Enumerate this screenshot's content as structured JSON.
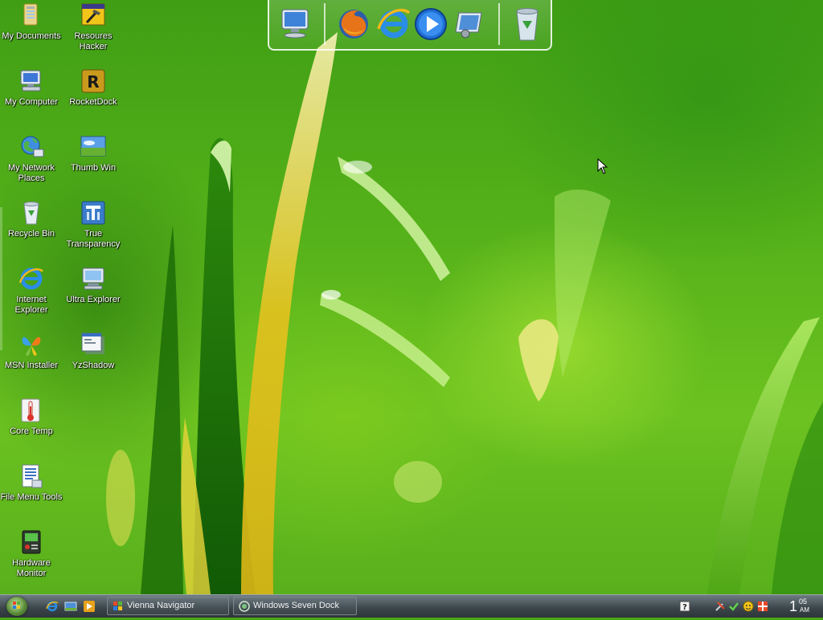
{
  "desktop_icons": {
    "my_documents": "My Documents",
    "resource_hacker": "Resoures Hacker",
    "my_computer": "My Computer",
    "rocketdock": "RocketDock",
    "my_network_places": "My Network Places",
    "thumb_win": "Thumb Win",
    "recycle_bin": "Recycle Bin",
    "true_transparency": "True Transparency",
    "internet_explorer": "Internet Explorer",
    "ultra_explorer": "Ultra Explorer",
    "msn_installer": "MSN Installer",
    "yzshadow": "YzShadow",
    "core_temp": "Core Temp",
    "file_menu_tools": "File Menu Tools",
    "hardware_monitor": "Hardware Monitor"
  },
  "dock": {
    "items": [
      "computer-icon",
      "firefox-icon",
      "internet-explorer-icon",
      "media-player-icon",
      "control-panel-icon",
      "recycle-bin-icon"
    ]
  },
  "taskbar": {
    "tasks": {
      "vienna_navigator": "Vienna Navigator",
      "windows_seven_dock": "Windows Seven Dock"
    },
    "clock": {
      "hour": "1",
      "minute": "05",
      "ampm": "AM"
    }
  },
  "colors": {
    "wallpaper_green": "#4aa615",
    "taskbar": "#3a4449",
    "label_text": "#ffffff"
  }
}
